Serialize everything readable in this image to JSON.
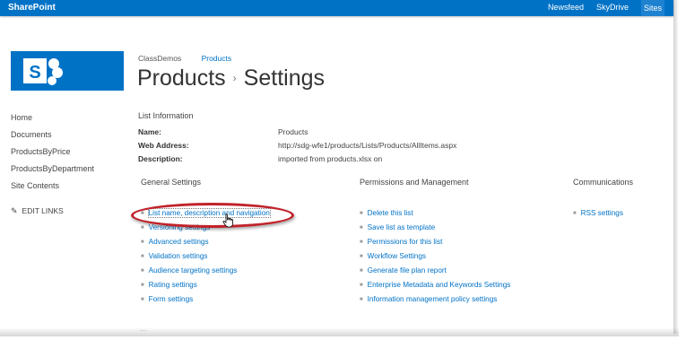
{
  "suitebar": {
    "brand": "SharePoint",
    "links": [
      "Newsfeed",
      "SkyDrive",
      "Sites"
    ]
  },
  "breadcrumb": {
    "site": "ClassDemos",
    "list": "Products"
  },
  "title": {
    "list": "Products",
    "page": "Settings"
  },
  "leftnav": [
    "Home",
    "Documents",
    "ProductsByPrice",
    "ProductsByDepartment",
    "Site Contents"
  ],
  "edit_links": "EDIT LINKS",
  "list_information": {
    "heading": "List Information",
    "name_label": "Name:",
    "name": "Products",
    "web_address_label": "Web Address:",
    "web_address": "http://sdg-wfe1/products/Lists/Products/AllItems.aspx",
    "description_label": "Description:",
    "description": "imported from products.xlsx on"
  },
  "general_settings": {
    "heading": "General Settings",
    "items": [
      "List name, description and navigation",
      "Versioning settings",
      "Advanced settings",
      "Validation settings",
      "Audience targeting settings",
      "Rating settings",
      "Form settings"
    ]
  },
  "permissions": {
    "heading": "Permissions and Management",
    "items": [
      "Delete this list",
      "Save list as template",
      "Permissions for this list",
      "Workflow Settings",
      "Generate file plan report",
      "Enterprise Metadata and Keywords Settings",
      "Information management policy settings"
    ]
  },
  "communications": {
    "heading": "Communications",
    "items": [
      "RSS settings"
    ]
  },
  "colors": {
    "suitebar": "#0072c6",
    "link": "#0072c6",
    "highlight": "#c0222a"
  }
}
